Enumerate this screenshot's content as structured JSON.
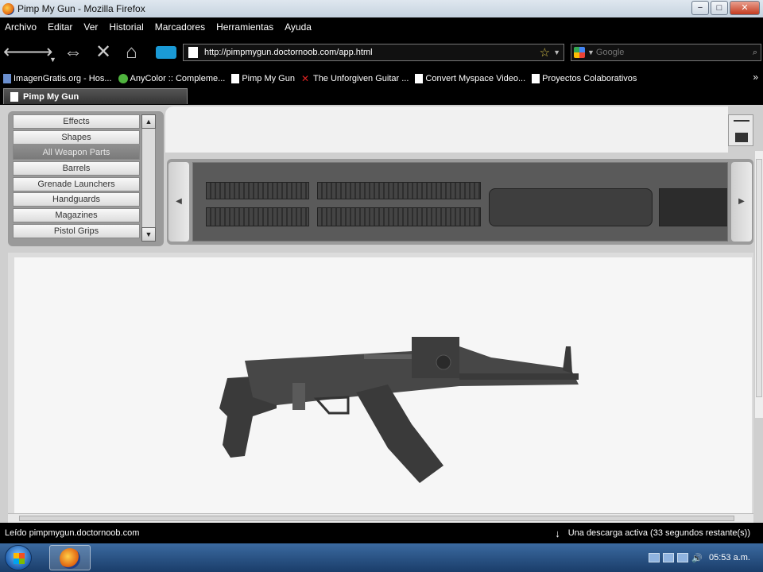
{
  "window": {
    "title": "Pimp My Gun - Mozilla Firefox",
    "min": "−",
    "max": "□",
    "close": "✕"
  },
  "menu": [
    "Archivo",
    "Editar",
    "Ver",
    "Historial",
    "Marcadores",
    "Herramientas",
    "Ayuda"
  ],
  "address": {
    "url": "http://pimpmygun.doctornoob.com/app.html"
  },
  "search": {
    "placeholder": "Google"
  },
  "bookmarks": [
    "ImagenGratis.org - Hos...",
    "AnyColor :: Compleme...",
    "Pimp My Gun",
    "The Unforgiven Guitar ...",
    "Convert Myspace Video...",
    "Proyectos Colaborativos"
  ],
  "tab": {
    "label": "Pimp My Gun"
  },
  "parts_list": [
    "Effects",
    "Shapes",
    "All Weapon Parts",
    "Barrels",
    "Grenade Launchers",
    "Handguards",
    "Magazines",
    "Pistol Grips"
  ],
  "parts_list_selected": "All Weapon Parts",
  "status": {
    "left": "Leído pimpmygun.doctornoob.com",
    "download": "Una descarga activa (33 segundos restante(s))"
  },
  "clock": "05:53 a.m.",
  "colors": {
    "menubar": "#000000",
    "panel": "#cfcfcf",
    "canvas": "#f6f6f6",
    "gun": "#3a3a3a"
  }
}
